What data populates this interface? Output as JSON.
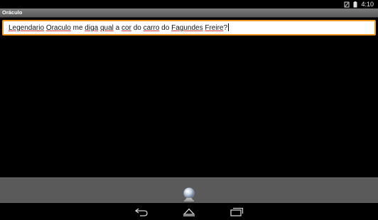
{
  "status_bar": {
    "time": "4:10",
    "icons": [
      "no-sim-icon",
      "battery-icon"
    ]
  },
  "app": {
    "title": "Oráculo"
  },
  "question": {
    "words": [
      {
        "text": "Legendario",
        "misspelled": true
      },
      {
        "text": " ",
        "misspelled": false
      },
      {
        "text": "Oraculo",
        "misspelled": true
      },
      {
        "text": " me ",
        "misspelled": false
      },
      {
        "text": "diga",
        "misspelled": true
      },
      {
        "text": " ",
        "misspelled": false
      },
      {
        "text": "qual",
        "misspelled": true
      },
      {
        "text": " a ",
        "misspelled": false
      },
      {
        "text": "cor",
        "misspelled": true
      },
      {
        "text": " do ",
        "misspelled": false
      },
      {
        "text": "carro",
        "misspelled": true
      },
      {
        "text": " do ",
        "misspelled": false
      },
      {
        "text": "Fagundes",
        "misspelled": true
      },
      {
        "text": " ",
        "misspelled": false
      },
      {
        "text": "Freire",
        "misspelled": true
      },
      {
        "text": "?",
        "misspelled": false
      }
    ]
  },
  "action_bar": {
    "button_icon": "crystal-ball-icon"
  },
  "nav_bar": {
    "buttons": [
      "back-icon",
      "home-icon",
      "recent-apps-icon"
    ]
  },
  "colors": {
    "input_border": "#f29a23",
    "title_bar": "#6a6a6a",
    "action_bar": "#5a5a5a",
    "spellcheck_underline": "#d23c3c"
  }
}
